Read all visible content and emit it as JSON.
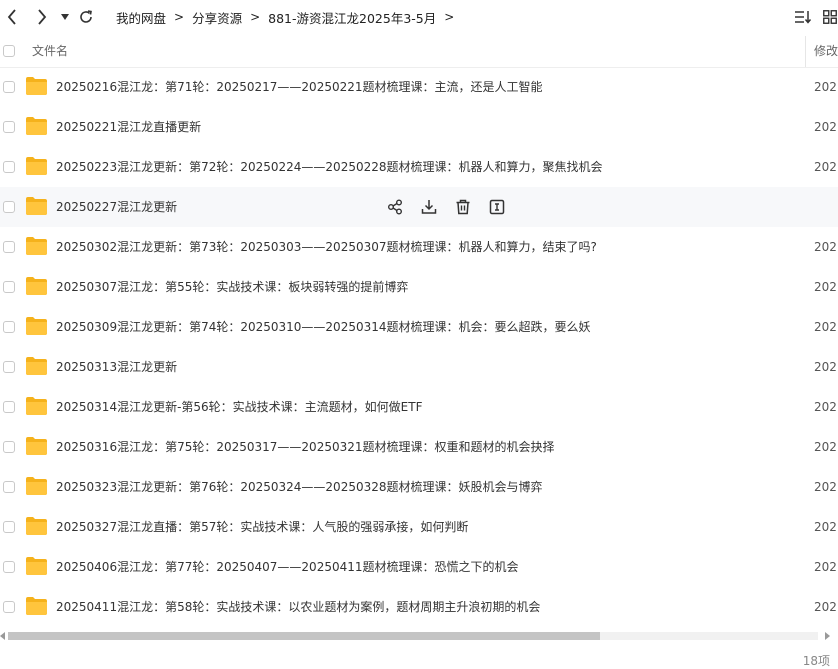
{
  "toolbar": {
    "breadcrumbs": [
      "我的网盘",
      "分享资源",
      "881-游资混江龙2025年3-5月"
    ],
    "separator": ">"
  },
  "header": {
    "col_name": "文件名",
    "col_modified": "修改"
  },
  "rows": [
    {
      "name": "20250216混江龙：第71轮：20250217——20250221题材梳理课：主流，还是人工智能",
      "date": "202"
    },
    {
      "name": "20250221混江龙直播更新",
      "date": "202"
    },
    {
      "name": "20250223混江龙更新：第72轮：20250224——20250228题材梳理课：机器人和算力，聚焦找机会",
      "date": "202"
    },
    {
      "name": "20250227混江龙更新",
      "date": ""
    },
    {
      "name": "20250302混江龙更新：第73轮：20250303——20250307题材梳理课：机器人和算力，结束了吗?",
      "date": "202"
    },
    {
      "name": "20250307混江龙：第55轮：实战技术课：板块弱转强的提前博弈",
      "date": "202"
    },
    {
      "name": "20250309混江龙更新：第74轮：20250310——20250314题材梳理课：机会：要么超跌，要么妖",
      "date": "202"
    },
    {
      "name": "20250313混江龙更新",
      "date": "202"
    },
    {
      "name": "20250314混江龙更新-第56轮：实战技术课：主流题材，如何做ETF",
      "date": "202"
    },
    {
      "name": "20250316混江龙：第75轮：20250317——20250321题材梳理课：权重和题材的机会抉择",
      "date": "202"
    },
    {
      "name": "20250323混江龙更新：第76轮：20250324——20250328题材梳理课：妖股机会与博弈",
      "date": "202"
    },
    {
      "name": "20250327混江龙直播：第57轮：实战技术课：人气股的强弱承接，如何判断",
      "date": "202"
    },
    {
      "name": "20250406混江龙：第77轮：20250407——20250411题材梳理课：恐慌之下的机会",
      "date": "202"
    },
    {
      "name": "20250411混江龙：第58轮：实战技术课：以农业题材为案例，题材周期主升浪初期的机会",
      "date": "202"
    }
  ],
  "status": {
    "count": "18项"
  },
  "colors": {
    "folder": "#ffc53d",
    "folder_back": "#f5b21c",
    "hover_row": "#f7f8fa",
    "scroll_thumb": "#c4c4c4"
  },
  "icons": [
    "back-icon",
    "forward-icon",
    "dropdown-icon",
    "refresh-icon",
    "sort-icon",
    "grid-view-icon",
    "folder-icon",
    "share-icon",
    "download-icon",
    "delete-icon",
    "rename-icon"
  ]
}
